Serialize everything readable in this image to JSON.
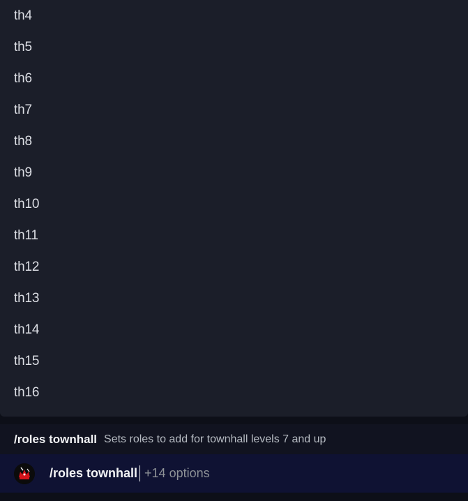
{
  "options": [
    {
      "label": "th4"
    },
    {
      "label": "th5"
    },
    {
      "label": "th6"
    },
    {
      "label": "th7"
    },
    {
      "label": "th8"
    },
    {
      "label": "th9"
    },
    {
      "label": "th10"
    },
    {
      "label": "th11"
    },
    {
      "label": "th12"
    },
    {
      "label": "th13"
    },
    {
      "label": "th14"
    },
    {
      "label": "th15"
    },
    {
      "label": "th16"
    }
  ],
  "command_hint": {
    "name": "/roles townhall",
    "description": "Sets roles to add for townhall levels 7 and up"
  },
  "input": {
    "avatar_icon": "bot-avatar-icon",
    "command": "/roles townhall",
    "extra_options": "+14 options"
  },
  "colors": {
    "panel": "#1b1e29",
    "input_bar": "#0f1233",
    "accent_red": "#d4141b"
  }
}
